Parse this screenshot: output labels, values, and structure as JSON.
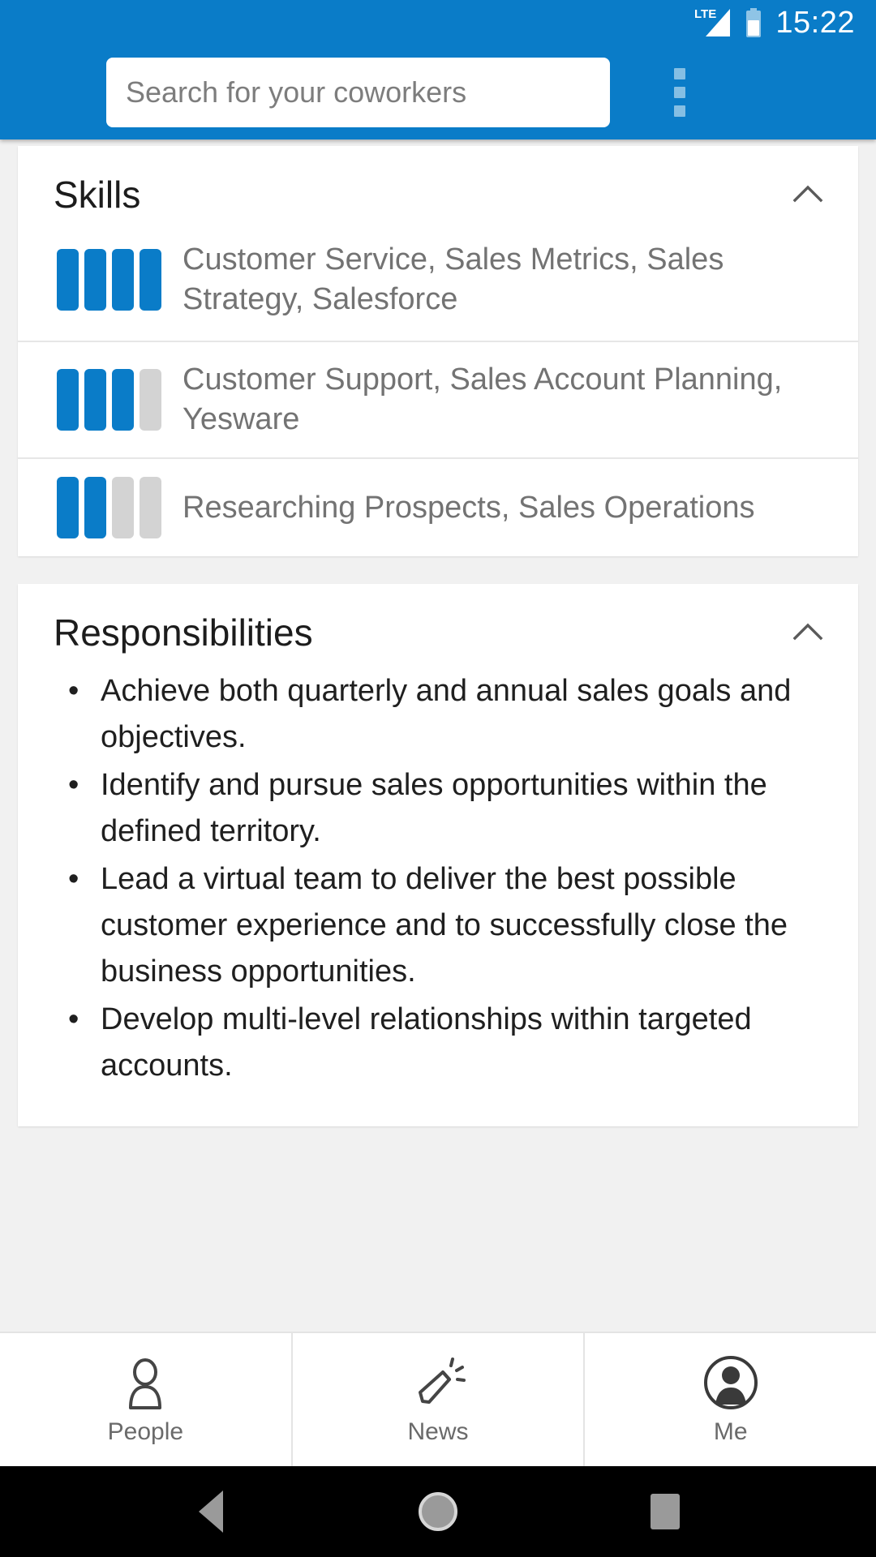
{
  "statusbar": {
    "network_label": "LTE",
    "time": "15:22",
    "signal_icon": "signal-bars-icon",
    "battery_icon": "battery-icon"
  },
  "appbar": {
    "search_placeholder": "Search for your coworkers",
    "search_value": "",
    "overflow_icon": "overflow-menu-icon",
    "background_color": "#0a7cc8"
  },
  "skills_card": {
    "title": "Skills",
    "collapse_icon": "chevron-up-icon",
    "max_rating": 4,
    "rows": [
      {
        "rating": 4,
        "label": "Customer Service, Sales Metrics, Sales Strategy, Salesforce"
      },
      {
        "rating": 3,
        "label": "Customer Support, Sales Account Planning, Yesware"
      },
      {
        "rating": 2,
        "label": "Researching Prospects, Sales Operations"
      }
    ]
  },
  "responsibilities_card": {
    "title": "Responsibilities",
    "collapse_icon": "chevron-up-icon",
    "items": [
      "Achieve both quarterly and annual sales goals and objectives.",
      "Identify and pursue sales opportunities within the defined territory.",
      "Lead a virtual team to deliver the best possible customer experience and to successfully close the business opportunities.",
      "Develop multi-level relationships within targeted accounts."
    ]
  },
  "tabbar": {
    "tabs": [
      {
        "label": "People",
        "icon": "person-outline-icon"
      },
      {
        "label": "News",
        "icon": "megaphone-icon"
      },
      {
        "label": "Me",
        "icon": "avatar-circle-icon"
      }
    ]
  },
  "navbar": {
    "back": "back-triangle-icon",
    "home": "home-circle-icon",
    "recent": "recent-apps-square-icon"
  },
  "colors": {
    "accent": "#0a7cc8",
    "bar_filled": "#0a7cc8",
    "bar_empty": "#d3d3d3",
    "page_bg": "#f1f1f1",
    "card_bg": "#ffffff",
    "skill_text": "#737373",
    "body_text": "#1f1f1f"
  }
}
